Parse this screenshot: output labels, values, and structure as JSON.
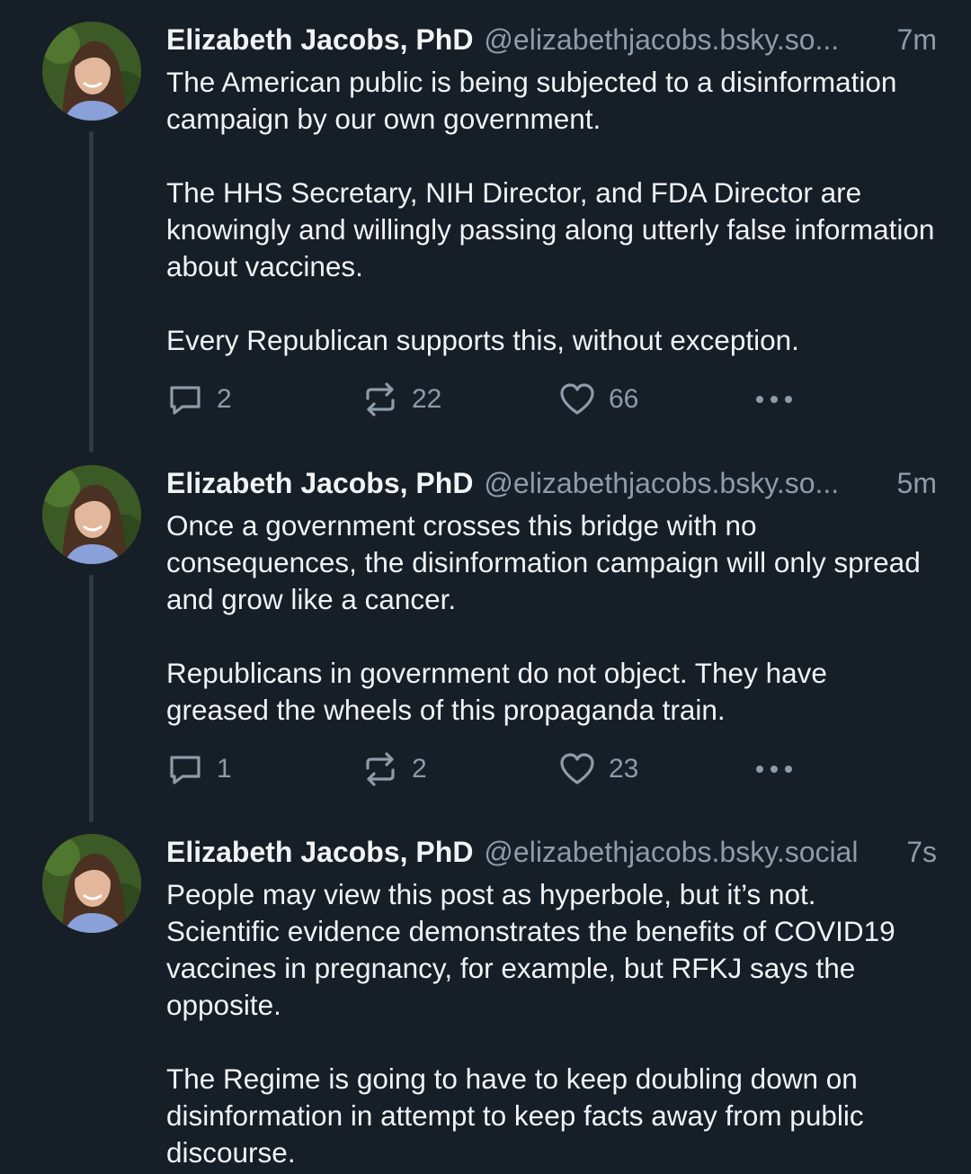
{
  "posts": [
    {
      "author_name": "Elizabeth Jacobs, PhD",
      "handle": "@elizabethjacobs.bsky.so...",
      "time": "7m",
      "paragraphs": [
        "The American public is being subjected to a disinformation campaign by our own government.",
        "The HHS Secretary, NIH Director, and FDA Director are knowingly and willingly passing along utterly false information about vaccines.",
        "Every Republican supports this, without exception."
      ],
      "reply_count": "2",
      "repost_count": "22",
      "like_count": "66"
    },
    {
      "author_name": "Elizabeth Jacobs, PhD",
      "handle": "@elizabethjacobs.bsky.so...",
      "time": "5m",
      "paragraphs": [
        "Once a government crosses this bridge with no consequences, the disinformation campaign will only spread and grow like a cancer.",
        "Republicans in government do not object. They have greased the wheels of this propaganda train."
      ],
      "reply_count": "1",
      "repost_count": "2",
      "like_count": "23"
    },
    {
      "author_name": "Elizabeth Jacobs, PhD",
      "handle": "@elizabethjacobs.bsky.social",
      "time": "7s",
      "paragraphs": [
        "People may view this post as hyperbole, but it’s not. Scientific evidence demonstrates the benefits of COVID19 vaccines in pregnancy, for example, but RFKJ says the opposite.",
        "The Regime is going to have to keep doubling down on disinformation in attempt to keep facts away from public discourse."
      ]
    }
  ],
  "icons": {
    "reply": "speech-bubble-icon",
    "repost": "repost-arrows-icon",
    "like": "heart-icon",
    "more": "ellipsis-icon"
  },
  "colors": {
    "background": "#161e27",
    "text": "#f1f3f5",
    "muted": "#8d9bab",
    "thread_line": "#2e3a47"
  }
}
